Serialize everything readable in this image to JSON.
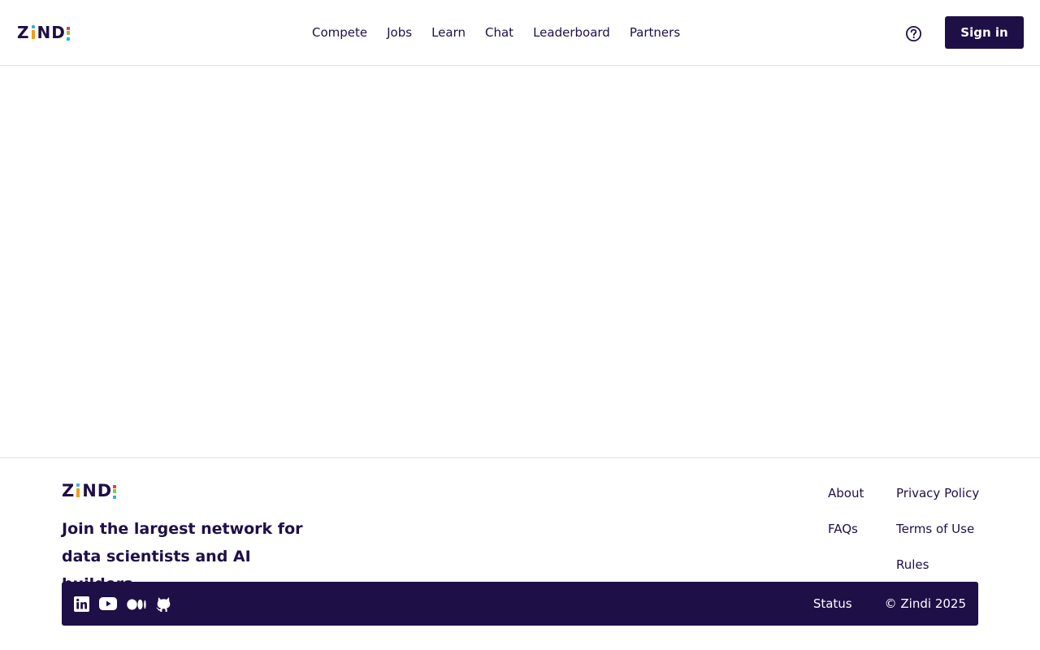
{
  "brand": {
    "logo_text": "Zindi",
    "colors": {
      "primary": "#1f0f47",
      "accent_blue": "#30b0e8",
      "accent_orange": "#f49b1c",
      "accent_red": "#e7413a",
      "accent_green": "#8dc63f"
    }
  },
  "header": {
    "nav": [
      "Compete",
      "Jobs",
      "Learn",
      "Chat",
      "Leaderboard",
      "Partners"
    ],
    "help_icon": "question-circle-icon",
    "sign_in_label": "Sign in"
  },
  "footer": {
    "tagline_line1": "Join the largest network for",
    "tagline_line2": "data scientists and AI builders",
    "links_col1": [
      "About",
      "FAQs"
    ],
    "links_col2": [
      "Privacy Policy",
      "Terms of Use",
      "Rules"
    ],
    "social_icons": [
      "linkedin-icon",
      "youtube-icon",
      "medium-icon",
      "github-icon"
    ],
    "status_label": "Status",
    "copyright": "© Zindi 2025"
  }
}
